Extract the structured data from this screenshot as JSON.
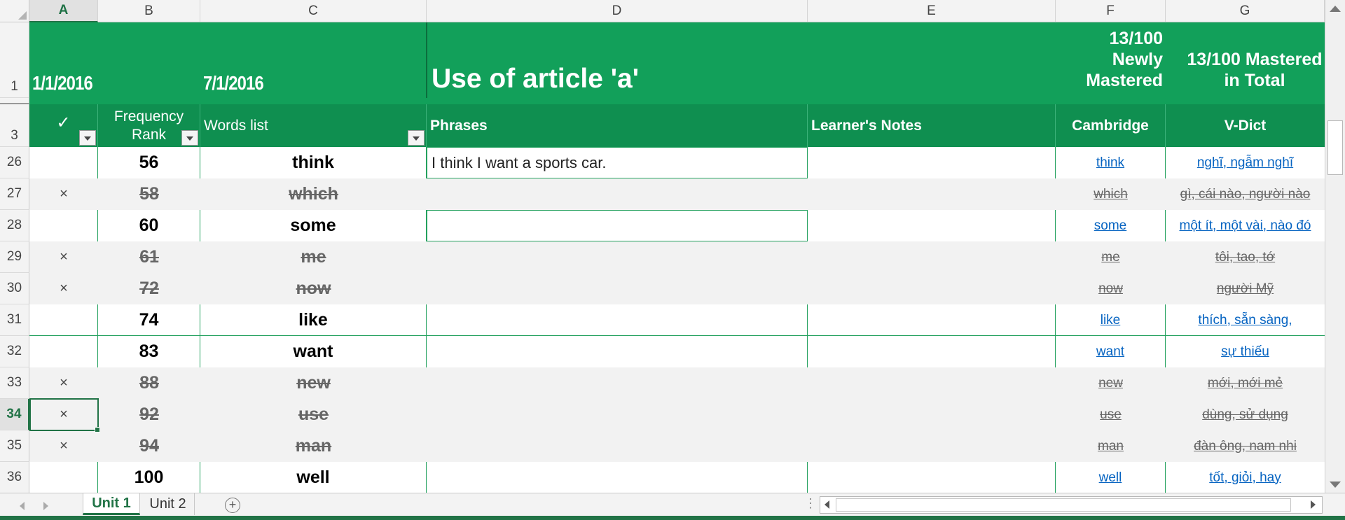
{
  "sheet": {
    "columns": [
      "A",
      "B",
      "C",
      "D",
      "E",
      "F",
      "G"
    ],
    "selected_column": "A",
    "row_numbers": {
      "r1": "1",
      "r3": "3"
    }
  },
  "banner": {
    "date_start": "1/1/2016",
    "date_end": "7/1/2016",
    "title": "Use of article 'a'",
    "newly_mastered_line1": "13/100",
    "newly_mastered_line2": "Newly",
    "newly_mastered_line3": "Mastered",
    "total_mastered_line1": "13/100 Mastered",
    "total_mastered_line2": "in Total"
  },
  "headers": {
    "check": "✓",
    "rank_line1": "Frequency",
    "rank_line2": "Rank",
    "words": "Words list",
    "phrases": "Phrases",
    "notes": "Learner's Notes",
    "cambridge": "Cambridge",
    "vdict": "V-Dict"
  },
  "rows": [
    {
      "row": "26",
      "mark": "",
      "rank": "56",
      "word": "think",
      "phrase": "I think I want a sports car.",
      "notes": "",
      "cambridge": "think",
      "vdict": "nghĩ, ngẫm nghĩ",
      "mastered": false
    },
    {
      "row": "27",
      "mark": "×",
      "rank": "58",
      "word": "which",
      "phrase": "",
      "notes": "",
      "cambridge": "which",
      "vdict": "gì, cái nào, người nào",
      "mastered": true
    },
    {
      "row": "28",
      "mark": "",
      "rank": "60",
      "word": "some",
      "phrase": "",
      "notes": "",
      "cambridge": "some",
      "vdict": "một ít, một vài, nào đó",
      "mastered": false
    },
    {
      "row": "29",
      "mark": "×",
      "rank": "61",
      "word": "me",
      "phrase": "",
      "notes": "",
      "cambridge": "me",
      "vdict": "tôi, tao, tớ",
      "mastered": true
    },
    {
      "row": "30",
      "mark": "×",
      "rank": "72",
      "word": "now",
      "phrase": "",
      "notes": "",
      "cambridge": "now",
      "vdict": "người Mỹ",
      "mastered": true
    },
    {
      "row": "31",
      "mark": "",
      "rank": "74",
      "word": "like",
      "phrase": "",
      "notes": "",
      "cambridge": "like",
      "vdict": "thích, sẵn sàng,",
      "mastered": false
    },
    {
      "row": "32",
      "mark": "",
      "rank": "83",
      "word": "want",
      "phrase": "",
      "notes": "",
      "cambridge": "want",
      "vdict": "sự thiếu",
      "mastered": false
    },
    {
      "row": "33",
      "mark": "×",
      "rank": "88",
      "word": "new",
      "phrase": "",
      "notes": "",
      "cambridge": "new",
      "vdict": "mới, mới mẻ",
      "mastered": true
    },
    {
      "row": "34",
      "mark": "×",
      "rank": "92",
      "word": "use",
      "phrase": "",
      "notes": "",
      "cambridge": "use",
      "vdict": "dùng, sử dụng",
      "mastered": true
    },
    {
      "row": "35",
      "mark": "×",
      "rank": "94",
      "word": "man",
      "phrase": "",
      "notes": "",
      "cambridge": "man",
      "vdict": "đàn ông, nam nhi",
      "mastered": true
    },
    {
      "row": "36",
      "mark": "",
      "rank": "100",
      "word": "well",
      "phrase": "",
      "notes": "",
      "cambridge": "well",
      "vdict": "tốt, giỏi, hay",
      "mastered": false
    }
  ],
  "selected_row": "34",
  "tabs": [
    {
      "label": "Unit 1",
      "active": true
    },
    {
      "label": "Unit 2",
      "active": false
    }
  ],
  "icons": {
    "add_sheet": "+",
    "more": "⋮"
  },
  "colors": {
    "banner": "#12a05a",
    "header": "#0f8f50",
    "link": "#0563c1",
    "excel_green": "#217346"
  }
}
